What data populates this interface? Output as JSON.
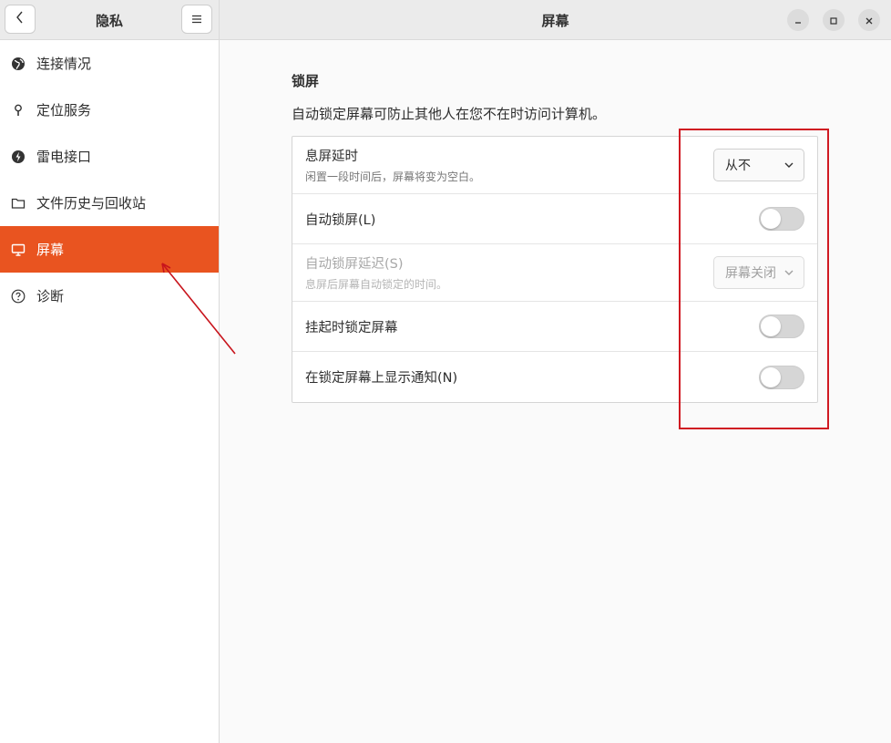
{
  "sidebar": {
    "title": "隐私",
    "items": [
      {
        "label": "连接情况",
        "icon": "globe-icon"
      },
      {
        "label": "定位服务",
        "icon": "location-pin-icon"
      },
      {
        "label": "雷电接口",
        "icon": "thunderbolt-icon"
      },
      {
        "label": "文件历史与回收站",
        "icon": "folder-icon"
      },
      {
        "label": "屏幕",
        "icon": "monitor-icon",
        "active": true
      },
      {
        "label": "诊断",
        "icon": "help-circle-icon"
      }
    ]
  },
  "main": {
    "title": "屏幕",
    "section_title": "锁屏",
    "section_desc": "自动锁定屏幕可防止其他人在您不在时访问计算机。",
    "rows": [
      {
        "title": "息屏延时",
        "subtitle": "闲置一段时间后，屏幕将变为空白。",
        "control": "dropdown",
        "value": "从不"
      },
      {
        "title": "自动锁屏(L)",
        "control": "toggle",
        "on": false
      },
      {
        "title": "自动锁屏延迟(S)",
        "subtitle": "息屏后屏幕自动锁定的时间。",
        "control": "dropdown",
        "value": "屏幕关闭",
        "disabled": true
      },
      {
        "title": "挂起时锁定屏幕",
        "control": "toggle",
        "on": false
      },
      {
        "title": "在锁定屏幕上显示通知(N)",
        "control": "toggle",
        "on": false
      }
    ]
  },
  "colors": {
    "accent": "#e95420",
    "annotation": "#d01a22"
  }
}
